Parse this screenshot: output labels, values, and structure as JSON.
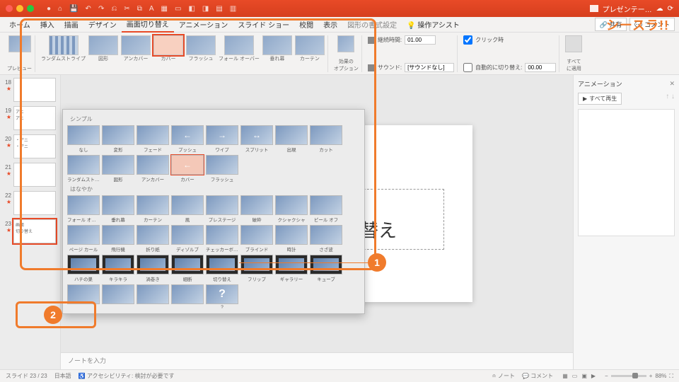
{
  "brand": "シースラ!!",
  "doc_title": "プレゼンテー…",
  "menus": {
    "home": "ホーム",
    "insert": "挿入",
    "draw": "描画",
    "design": "デザイン",
    "transitions": "画面切り替え",
    "animations": "アニメーション",
    "slideshow": "スライド ショー",
    "review": "校閲",
    "view": "表示",
    "format": "図形の書式設定",
    "assist": "操作アシスト"
  },
  "share": "共有",
  "comment_btn": "コメント",
  "ribbon": {
    "preview": "プレビュー",
    "items": [
      "ランダムストライプ",
      "図形",
      "アンカバー",
      "カバー",
      "フラッシュ",
      "フォール オーバー",
      "垂れ幕",
      "カーテン"
    ],
    "effect_opts": "効果の\nオプション",
    "duration_lbl": "継続時間:",
    "duration_val": "01.00",
    "sound_lbl": "サウンド:",
    "sound_val": "[サウンドなし]",
    "onclick": "クリック時",
    "auto": "自動的に切り替え:",
    "auto_val": "00.00",
    "apply_all": "すべて\nに適用"
  },
  "gallery": {
    "sec_subtle": "シンプル",
    "subtle": [
      "なし",
      "変形",
      "フェード",
      "プッシュ",
      "ワイプ",
      "スプリット",
      "出現",
      "カット",
      "ランダムストライプ",
      "図形",
      "アンカバー",
      "カバー",
      "フラッシュ"
    ],
    "sec_exciting": "はなやか",
    "exciting": [
      "フォール オーバー",
      "垂れ幕",
      "カーテン",
      "風",
      "プレステージ",
      "破砕",
      "クシャクシャ",
      "ピール オフ",
      "ページ カール",
      "飛行機",
      "折り紙",
      "ディゾルブ",
      "チェッカーボード",
      "ブラインド",
      "時計",
      "さざ波",
      "ハチの巣",
      "キラキラ",
      "渦巻き",
      "細断",
      "切り替え",
      "フリップ",
      "ギャラリー",
      "キューブ",
      "",
      "",
      "",
      "",
      "?"
    ]
  },
  "slide_text": "画面\n切り替え",
  "thumbs": {
    "nums": [
      "18",
      "",
      "19",
      "",
      "20",
      "",
      "21",
      "",
      "22",
      "",
      "23"
    ],
    "outline": [
      "アニ",
      "アニ",
      "・ アニ",
      "・ アニ",
      "",
      "",
      "",
      "画面\n切り替え"
    ]
  },
  "anim_pane": {
    "title": "アニメーション",
    "play": "すべて再生"
  },
  "notes_placeholder": "ノートを入力",
  "status": {
    "slide": "スライド 23 / 23",
    "lang": "日本語",
    "a11y": "アクセシビリティ: 検討が必要です",
    "notes": "ノート",
    "comments": "コメント",
    "zoom": "88%"
  },
  "callouts": {
    "one": "1",
    "two": "2"
  }
}
